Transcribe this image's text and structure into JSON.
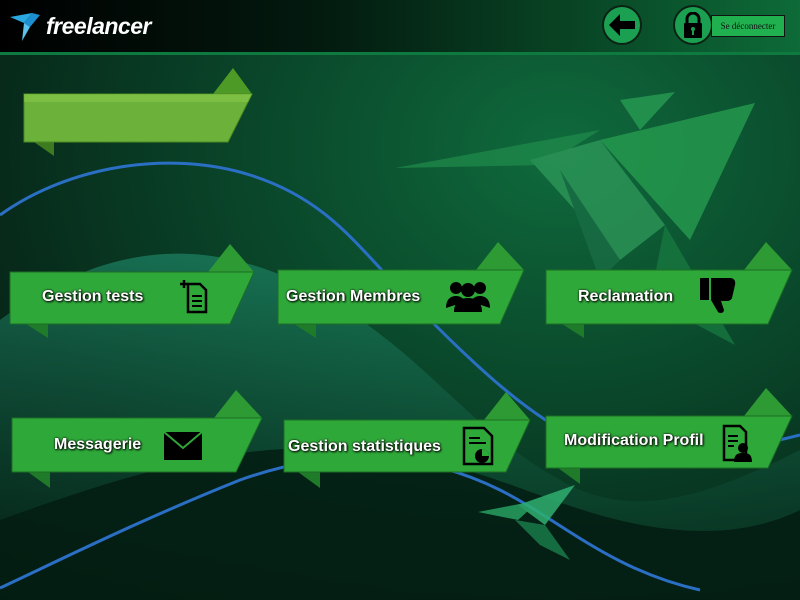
{
  "header": {
    "logo_text": "freelancer",
    "logout_label": "Se déconnecter",
    "icons": {
      "logo": "hummingbird-logo-icon",
      "back": "arrow-left-icon",
      "lock": "lock-icon"
    }
  },
  "banner": {
    "label": ""
  },
  "tiles": [
    {
      "label": "Gestion  tests",
      "icon": "add-document-icon"
    },
    {
      "label": "Gestion  Membres",
      "icon": "group-users-icon"
    },
    {
      "label": "Reclamation",
      "icon": "thumbs-down-icon"
    },
    {
      "label": "Messagerie",
      "icon": "envelope-icon"
    },
    {
      "label": "Gestion statistiques",
      "icon": "report-chart-icon"
    },
    {
      "label": "Modification Profil",
      "icon": "user-profile-document-icon"
    }
  ],
  "colors": {
    "header_accent": "#0f7a3f",
    "tile_green": "#2fa83a",
    "tile_fold": "#1f7a29",
    "banner_green": "#6cb23a",
    "wave_blue": "#2a6fc4"
  }
}
